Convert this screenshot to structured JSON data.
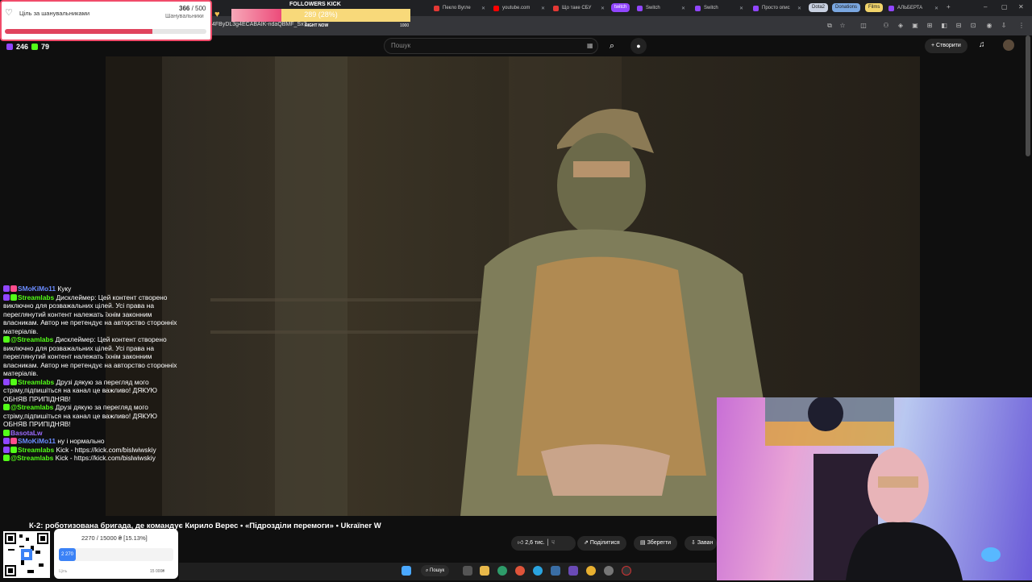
{
  "browser": {
    "tabs": [
      {
        "label": "Пекло Вугле",
        "color": "#e53935"
      },
      {
        "label": "youtube.com",
        "color": "#ff0000"
      },
      {
        "label": "Що таке СБУ",
        "color": "#e53935"
      },
      {
        "label": "twitch",
        "color": "#9146ff"
      },
      {
        "label": "Switch",
        "color": "#9146ff"
      },
      {
        "label": "Switch",
        "color": "#9146ff"
      },
      {
        "label": "Просто опис",
        "color": "#9146ff"
      },
      {
        "label": "АЛЬБЕРТА",
        "color": "#9146ff"
      }
    ],
    "bookmarks": [
      "Dota2",
      "Donations",
      "Films"
    ],
    "url_fragment": "4FByDL3g4ECABAIK-ndaQBMF_Sx7..."
  },
  "youtube": {
    "search_placeholder": "Пошук",
    "create_label": "Створити",
    "video_title": "К-2: роботизована бригада, де командує Кирило Верес • «Підрозділи перемоги» • Ukraïner W",
    "likes": "2,6 тис.",
    "share": "Поділитися",
    "save": "Зберегти",
    "download": "Заван"
  },
  "goal_widget": {
    "title": "Ціль за шанувальниками",
    "count": "366",
    "total": "500",
    "label": "Шанувальники",
    "progress": 0.73
  },
  "followers_kick": {
    "title": "FOLLOWERS KICK",
    "value": "289 (28%)",
    "progress": 0.28,
    "now": "RIGHT NOW",
    "max": "1000"
  },
  "stream": {
    "viewers_twitch": "246",
    "viewers_kick": "79"
  },
  "chat": [
    {
      "user": "SMoKiMo11",
      "color": "#6b8cff",
      "text": " Куку"
    },
    {
      "user": "Streamlabs",
      "color": "#53fc18",
      "text": " Дисклеймер: Цей контент створено виключно для розважальних цілей. Усі права на переглянутий контент належать їхнім законним власникам. Автор не претендує на авторство сторонніх матеріалів."
    },
    {
      "user": "@Streamlabs",
      "color": "#53fc18",
      "text": " Дисклеймер: Цей контент створено виключно для розважальних цілей. Усі права на переглянутий контент належать їхнім законним власникам. Автор не претендує на авторство сторонніх матеріалів."
    },
    {
      "user": "Streamlabs",
      "color": "#53fc18",
      "text": " Друзі дякую за перегляд мого стріму,підпишіться на канал це важливо! ДЯКУЮ ОБНЯВ ПРИПІДНЯВ!"
    },
    {
      "user": "@Streamlabs",
      "color": "#53fc18",
      "text": " Друзі дякую за перегляд мого стріму,підпишіться на канал це важливо! ДЯКУЮ ОБНЯВ ПРИПІДНЯВ!"
    },
    {
      "user": "BasotaLw",
      "color": "#9c6bff",
      "text": ""
    },
    {
      "user": "SMoKiMo11",
      "color": "#6b8cff",
      "text": " ну і нормально"
    },
    {
      "user": "Streamlabs",
      "color": "#53fc18",
      "text": " Kick - https://kick.com/bislwiwskiy"
    },
    {
      "user": "@Streamlabs",
      "color": "#53fc18",
      "text": " Kick - https://kick.com/bislwiwskiy"
    }
  ],
  "donation": {
    "text": "2270 / 15000 ₴ [15.13%]",
    "progress_label": "2 270",
    "progress": 0.1513,
    "min": "Ціль",
    "max": "15 000₴"
  },
  "taskbar": {
    "search": "Пошук"
  }
}
